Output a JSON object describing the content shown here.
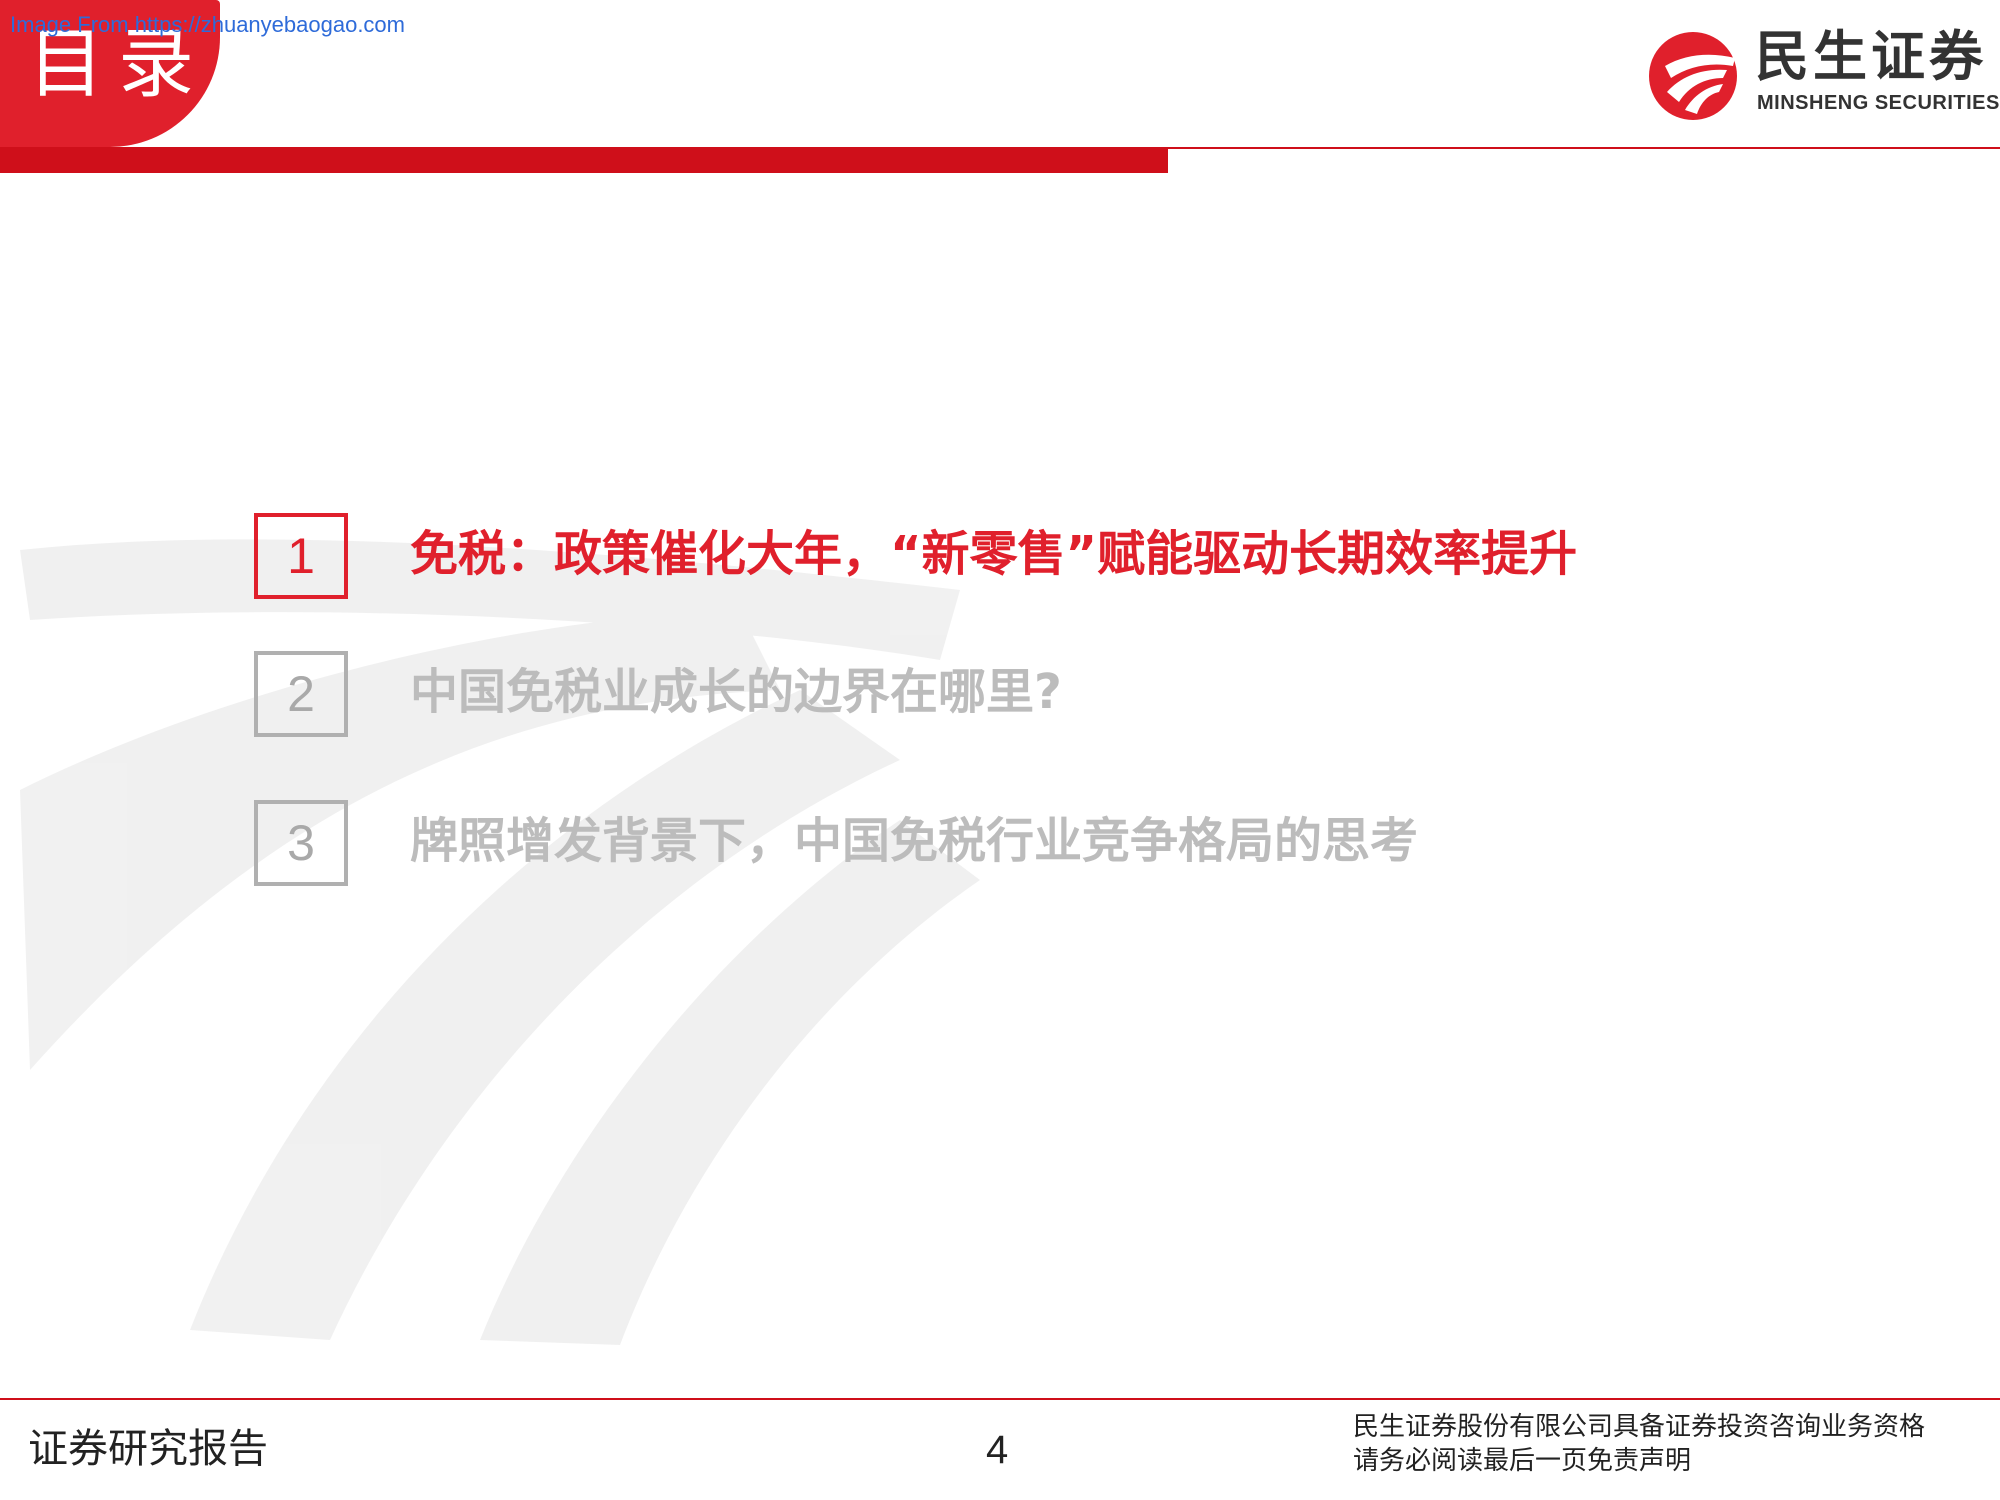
{
  "header": {
    "title": "目录",
    "source_link": "Image From https://zhuanyebaogao.com"
  },
  "logo": {
    "name_cn": "民生证券",
    "name_en": "MINSHENG SECURITIES",
    "icon": "minsheng-logo-icon",
    "brand_color": "#e0202c"
  },
  "toc": {
    "items": [
      {
        "number": "1",
        "label": "免税：政策催化大年，“新零售”赋能驱动长期效率提升",
        "active": true
      },
      {
        "number": "2",
        "label": "中国免税业成长的边界在哪里?",
        "active": false
      },
      {
        "number": "3",
        "label": "牌照增发背景下，中国免税行业竞争格局的思考",
        "active": false
      }
    ]
  },
  "footer": {
    "left_text": "证券研究报告",
    "page_number": "4",
    "disclaimer_line1": "民生证券股份有限公司具备证券投资咨询业务资格",
    "disclaimer_line2": "请务必阅读最后一页免责声明"
  },
  "colors": {
    "accent": "#e0202c",
    "inactive": "#bcbcbc",
    "link": "#2e6bd9"
  }
}
